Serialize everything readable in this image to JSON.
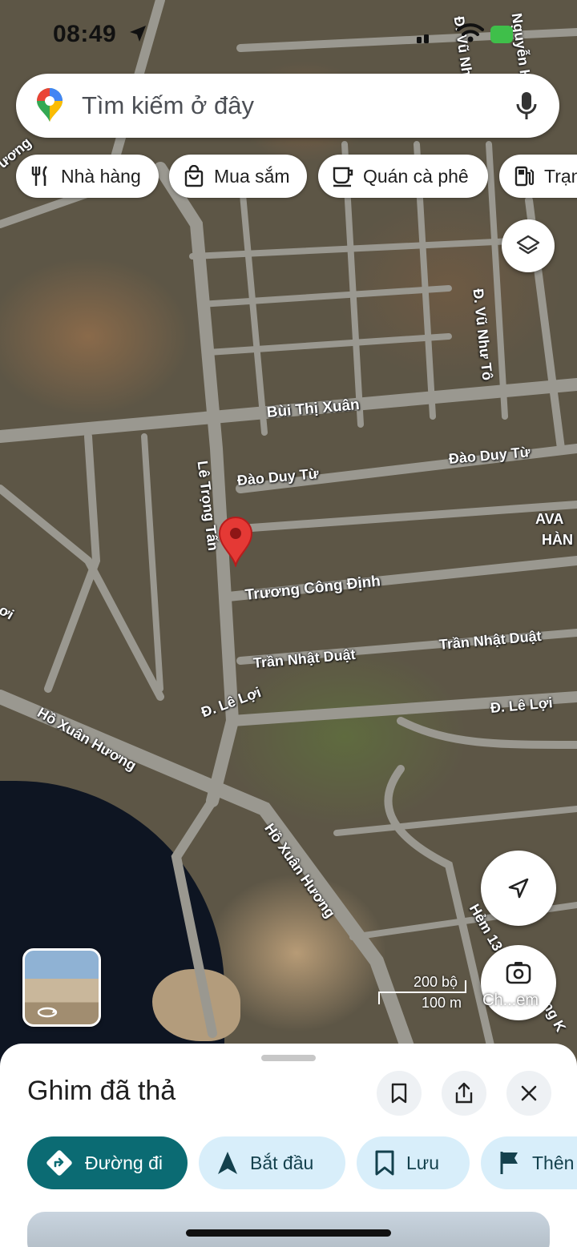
{
  "status_bar": {
    "time": "08:49"
  },
  "search": {
    "placeholder": "Tìm kiếm ở đây"
  },
  "chips": [
    {
      "label": "Nhà hàng",
      "icon": "restaurant-icon"
    },
    {
      "label": "Mua sắm",
      "icon": "shopping-bag-icon"
    },
    {
      "label": "Quán cà phê",
      "icon": "coffee-icon"
    },
    {
      "label": "Trạm",
      "icon": "gas-station-icon"
    }
  ],
  "map": {
    "streets": {
      "bui_thi_xuan": "Bùi Thị Xuân",
      "dao_duy_tu_left": "Đào Duy Từ",
      "dao_duy_tu_right": "Đào Duy Từ",
      "le_trong_tan": "Lê Trọng Tấn",
      "truong_cong_dinh": "Trương Công Định",
      "tran_nhat_duat_left": "Trần Nhật Duật",
      "tran_nhat_duat_right": "Trần Nhật Duật",
      "le_loi_left": "Đ. Lê Lợi",
      "le_loi_right": "Đ. Lê Lợi",
      "ho_xuan_huong_left": "Hồ Xuân Hương",
      "ho_xuan_huong_right": "Hồ Xuân Hương",
      "vu_nhu_to_top": "Đ. Vũ Nh",
      "vu_nhu_to": "Đ. Vũ Như Tô",
      "nguyen_top": "Nguyễn H",
      "hem_13": "Hẻm 13",
      "poi_ava": "AVA",
      "poi_han": "HÀN",
      "frag_left_top": "ương",
      "frag_left_mid": "ơi",
      "frag_right_bottom": "ơng K"
    },
    "scale": {
      "feet": "200 bộ",
      "meters": "100 m"
    },
    "lens_label": "Ch...em"
  },
  "sheet": {
    "title": "Ghim đã thả",
    "actions": [
      {
        "label": "Đường đi",
        "icon": "directions-icon"
      },
      {
        "label": "Bắt đầu",
        "icon": "navigation-icon"
      },
      {
        "label": "Lưu",
        "icon": "bookmark-icon"
      },
      {
        "label": "Thên",
        "icon": "flag-icon"
      }
    ]
  },
  "colors": {
    "primary_action": "#0b6b73",
    "secondary_action": "#d8eefa",
    "pin_red": "#e53935"
  }
}
